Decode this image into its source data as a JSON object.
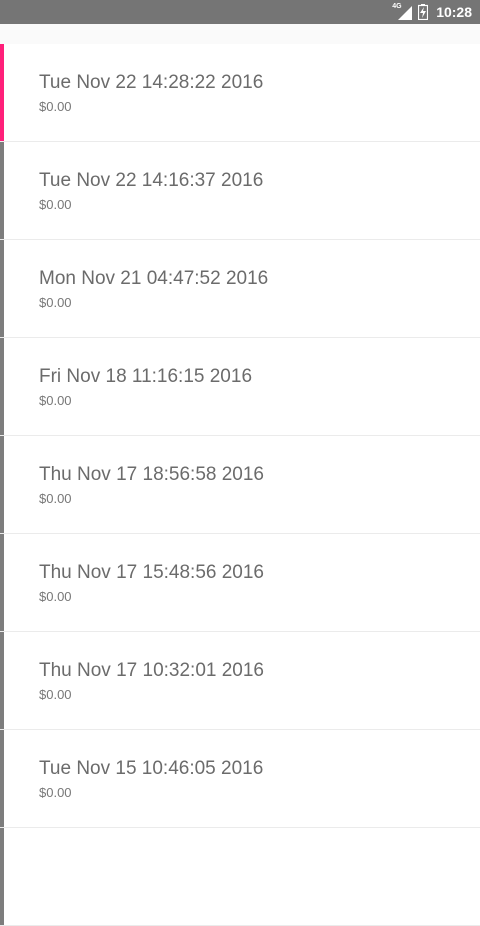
{
  "status_bar": {
    "network_type": "4G",
    "time": "10:28"
  },
  "colors": {
    "status_bar": "#757575",
    "selected_accent": "#ff1f7a",
    "default_accent": "#7d7d7d",
    "title_text": "#6b6b6b"
  },
  "list": {
    "items": [
      {
        "title": "Tue Nov 22 14:28:22 2016",
        "amount": "$0.00",
        "selected": true
      },
      {
        "title": "Tue Nov 22 14:16:37 2016",
        "amount": "$0.00",
        "selected": false
      },
      {
        "title": "Mon Nov 21 04:47:52 2016",
        "amount": "$0.00",
        "selected": false
      },
      {
        "title": "Fri Nov 18 11:16:15 2016",
        "amount": "$0.00",
        "selected": false
      },
      {
        "title": "Thu Nov 17 18:56:58 2016",
        "amount": "$0.00",
        "selected": false
      },
      {
        "title": "Thu Nov 17 15:48:56 2016",
        "amount": "$0.00",
        "selected": false
      },
      {
        "title": "Thu Nov 17 10:32:01 2016",
        "amount": "$0.00",
        "selected": false
      },
      {
        "title": "Tue Nov 15 10:46:05 2016",
        "amount": "$0.00",
        "selected": false
      },
      {
        "title": "",
        "amount": "",
        "selected": false
      }
    ]
  }
}
